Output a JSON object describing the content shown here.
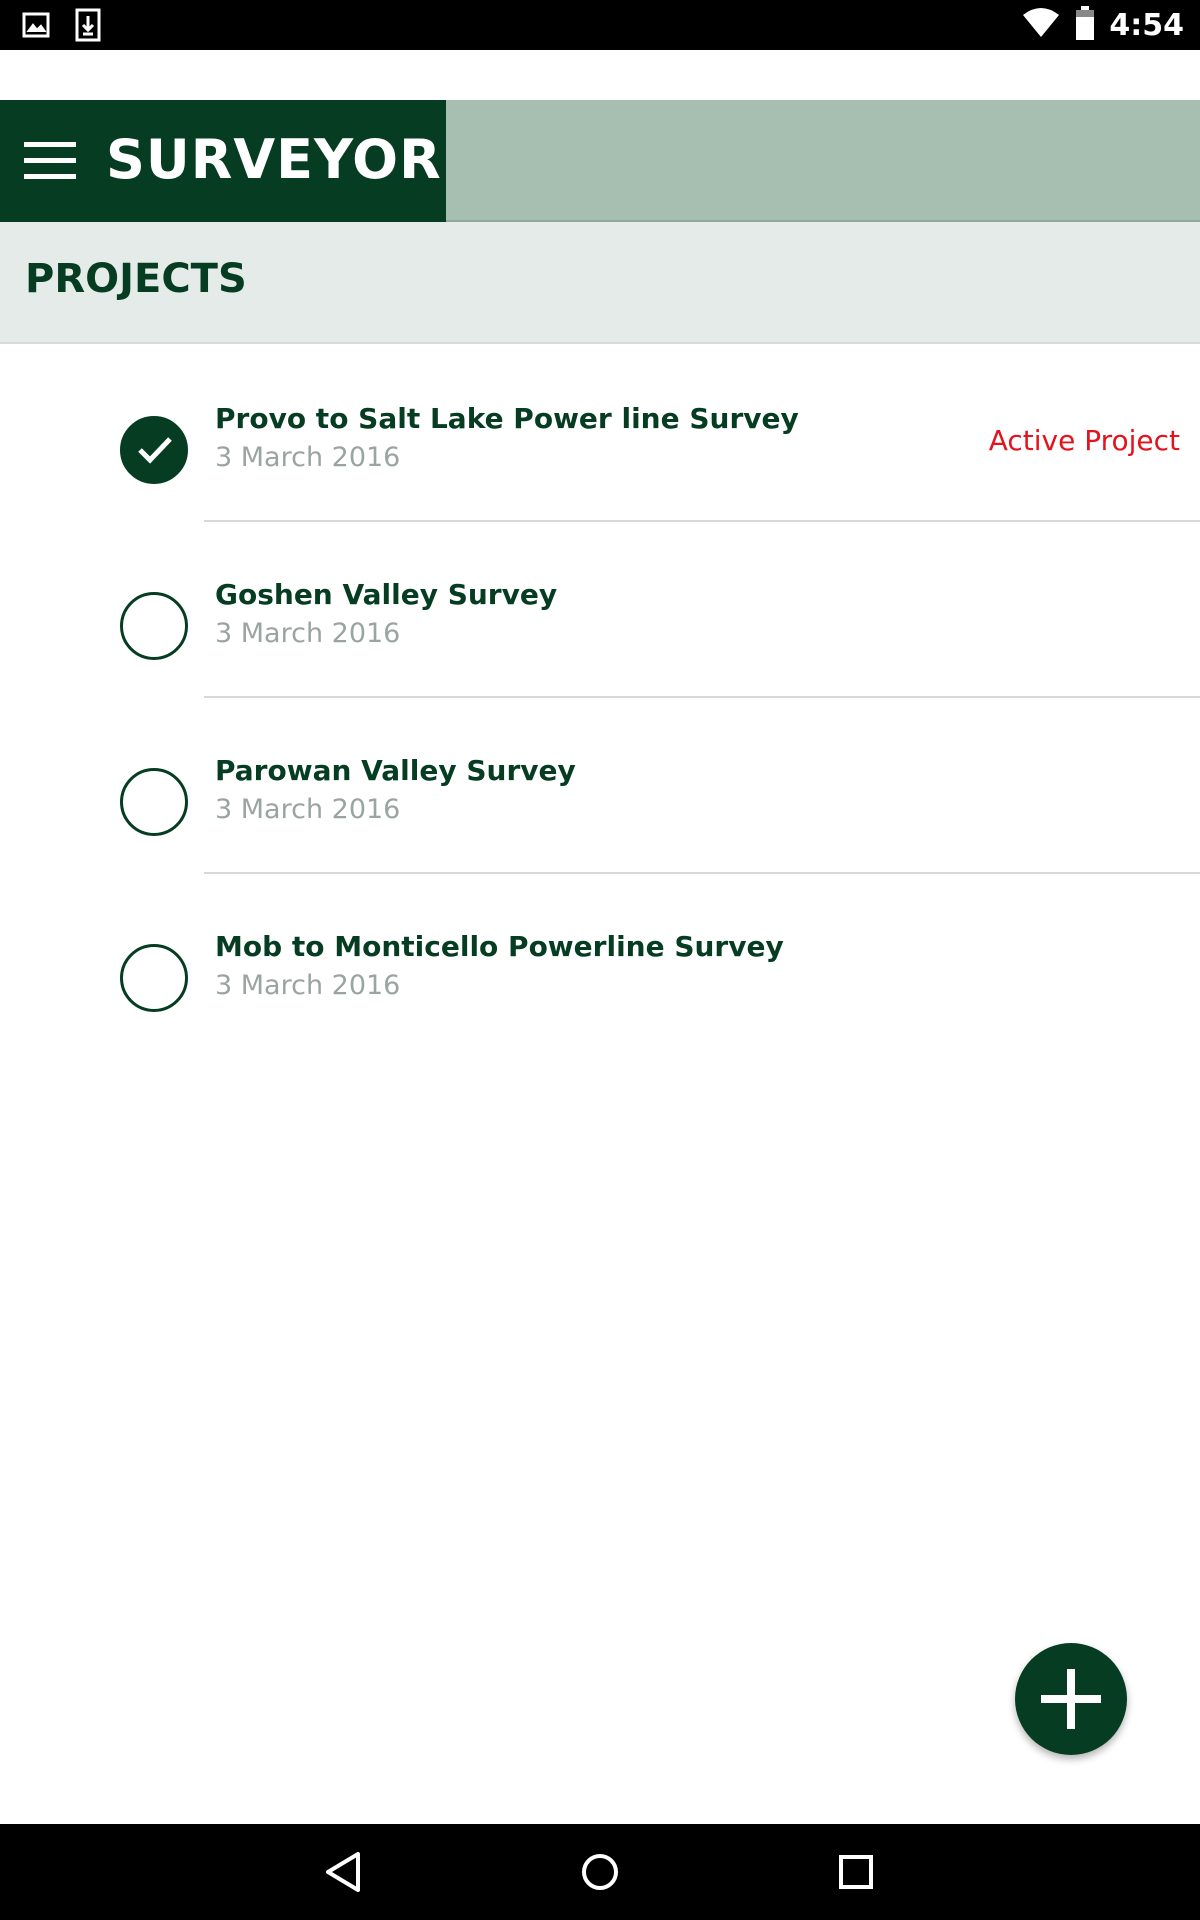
{
  "status_bar": {
    "time": "4:54",
    "icons": [
      "image-notification-icon",
      "download-notification-icon",
      "wifi-icon",
      "battery-icon"
    ]
  },
  "app_bar": {
    "title": "SURVEYOR",
    "menu_icon": "hamburger-menu-icon",
    "brand_color": "#063d22",
    "accent_color": "#a6bfb1"
  },
  "section": {
    "title": "PROJECTS"
  },
  "projects": [
    {
      "name": "Provo to Salt Lake Power line Survey",
      "date": "3 March 2016",
      "selected": true,
      "status": "Active Project"
    },
    {
      "name": "Goshen Valley Survey",
      "date": "3 March 2016",
      "selected": false,
      "status": ""
    },
    {
      "name": "Parowan Valley Survey",
      "date": "3 March 2016",
      "selected": false,
      "status": ""
    },
    {
      "name": "Mob to Monticello Powerline Survey",
      "date": "3 March 2016",
      "selected": false,
      "status": ""
    }
  ],
  "colors": {
    "active_status": "#e3141e",
    "date_text": "#9aa5a0"
  },
  "fab": {
    "icon": "plus-icon"
  },
  "nav_bar": {
    "icons": [
      "back-icon",
      "home-icon",
      "recents-icon"
    ]
  }
}
